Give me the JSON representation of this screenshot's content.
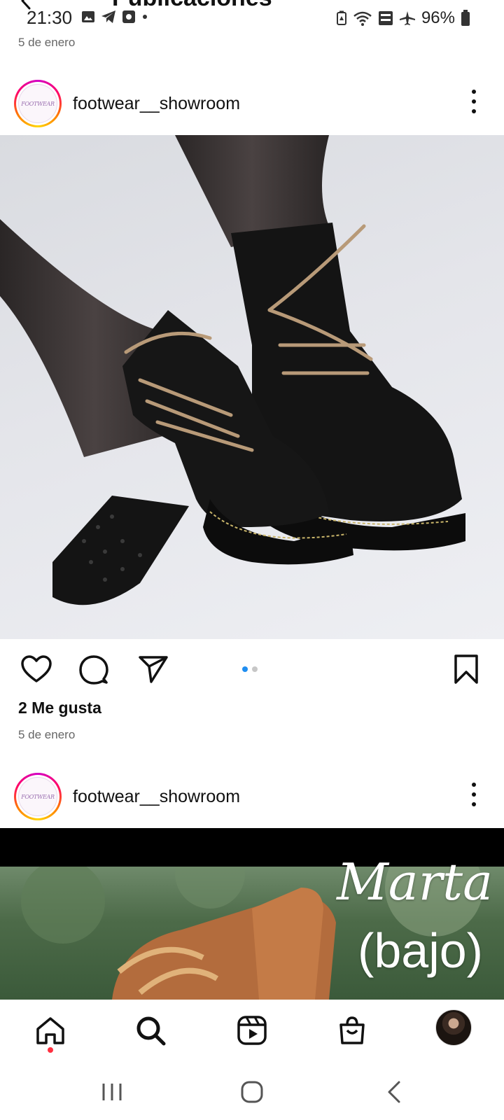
{
  "header": {
    "title": "Publicaciones"
  },
  "status_bar": {
    "time": "21:30",
    "battery": "96%"
  },
  "top_date": "5 de enero",
  "posts": [
    {
      "username": "footwear__showroom",
      "avatar_text": "FOOTWEAR",
      "likes": "2 Me gusta",
      "date": "5 de enero",
      "carousel": {
        "count": 2,
        "active": 1
      }
    },
    {
      "username": "footwear__showroom",
      "avatar_text": "FOOTWEAR",
      "overlay_line1": "Marta",
      "overlay_line2": "(bajo)"
    }
  ],
  "bottom_nav": [
    "home-icon",
    "search-icon",
    "reels-icon",
    "shop-icon",
    "profile-avatar"
  ],
  "colors": {
    "accent": "#1f8ef1",
    "notification": "#ff3040",
    "text": "#111111",
    "muted": "#666666"
  }
}
